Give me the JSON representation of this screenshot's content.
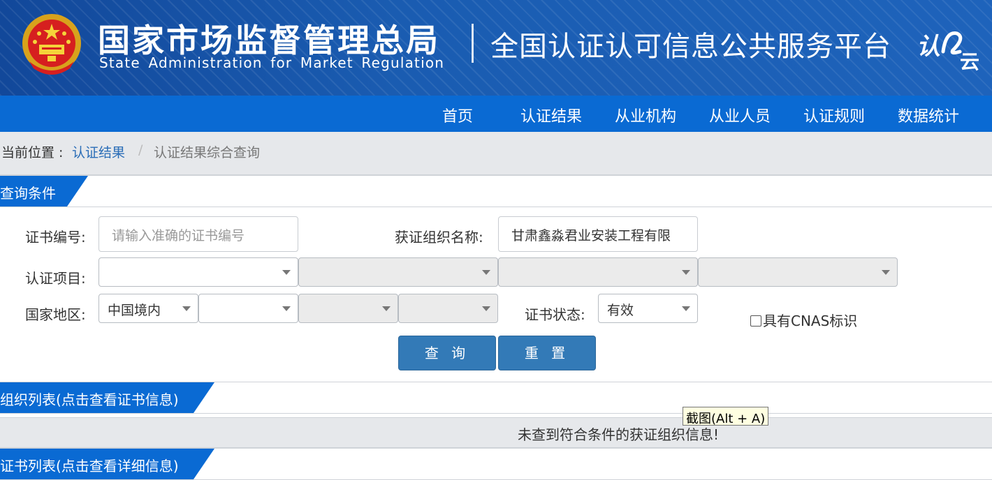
{
  "header": {
    "title_cn": "国家市场监督管理总局",
    "title_en": "State Administration  for  Market Regulation",
    "platform": "全国认证认可信息公共服务平台",
    "logo_icon": "ren-yun-cloud-logo-icon",
    "emblem_icon": "national-emblem-icon"
  },
  "nav": {
    "items": [
      "首页",
      "认证结果",
      "从业机构",
      "从业人员",
      "认证规则",
      "数据统计"
    ]
  },
  "breadcrumb": {
    "label": "当前位置 :",
    "link": "认证结果",
    "separator": "/",
    "current": "认证结果综合查询"
  },
  "query": {
    "section_title": "查询条件",
    "cert_no_label": "证书编号:",
    "cert_no_placeholder": "请输入准确的证书编号",
    "org_name_label": "获证组织名称:",
    "org_name_value": "甘肃鑫淼君业安装工程有限",
    "project_label": "认证项目:",
    "region_label": "国家地区:",
    "region_value": "中国境内",
    "status_label": "证书状态:",
    "status_value": "有效",
    "cnas_label": "具有CNAS标识",
    "search_button": "查 询",
    "reset_button": "重 置"
  },
  "org_list": {
    "section_title": "组织列表(点击查看证书信息)",
    "empty_message": "未查到符合条件的获证组织信息!"
  },
  "cert_list": {
    "section_title": "证书列表(点击查看详细信息)"
  },
  "tooltip": {
    "text": "截图(Alt + A)"
  },
  "colors": {
    "header_blue": "#1b5fb4",
    "nav_blue": "#0a6ad3",
    "button_blue": "#337ab7",
    "link_blue": "#2a6db7"
  }
}
